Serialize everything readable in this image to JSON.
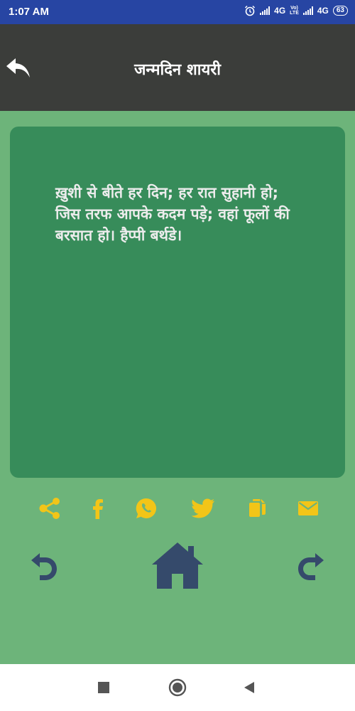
{
  "status_bar": {
    "time": "1:07 AM",
    "network_1": "4G",
    "volte_line1": "Vo)",
    "volte_line2": "LTE",
    "network_2": "4G",
    "battery": "63",
    "icons": [
      "alarm-icon",
      "signal-icon",
      "signal-icon",
      "battery-icon"
    ]
  },
  "app_bar": {
    "title": "जन्मदिन शायरी",
    "back_icon": "back-arrow-icon"
  },
  "content": {
    "shayari_text": "ख़ुशी से बीते हर दिन; हर रात सुहानी हो; जिस तरफ आपके कदम पड़े; वहां फूलों की बरसात हो। हैप्पी बर्थडे।"
  },
  "share_bar": {
    "icons": [
      "share-icon",
      "facebook-icon",
      "whatsapp-icon",
      "twitter-icon",
      "copy-icon",
      "email-icon"
    ]
  },
  "navigation": {
    "icons": [
      "undo-arrow-icon",
      "home-icon",
      "redo-arrow-icon"
    ]
  },
  "system_nav": {
    "icons": [
      "recents-square-icon",
      "home-circle-icon",
      "back-triangle-icon"
    ]
  },
  "colors": {
    "status_bar": "#2745a3",
    "app_bar": "#3b3d3a",
    "background": "#6db47a",
    "card": "#378c5a",
    "icon_yellow": "#f2c518",
    "icon_navy": "#354a6b"
  }
}
